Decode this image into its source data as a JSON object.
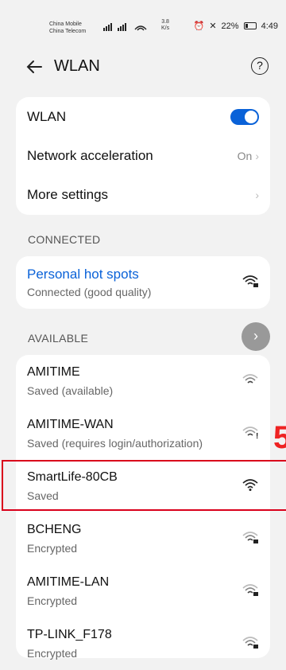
{
  "status": {
    "carrier1": "China Mobile",
    "carrier2": "China Telecom",
    "speed_value": "3.8",
    "speed_unit": "K/s",
    "battery": "22%",
    "time": "4:49"
  },
  "header": {
    "title": "WLAN"
  },
  "settings": {
    "wlan_label": "WLAN",
    "acceleration_label": "Network acceleration",
    "acceleration_value": "On",
    "more_label": "More settings"
  },
  "sections": {
    "connected": "CONNECTED",
    "available": "AVAILABLE"
  },
  "connected": {
    "name": "Personal  hot  spots",
    "status": "Connected (good quality)"
  },
  "available": [
    {
      "name": "AMITIME",
      "status": "Saved (available)"
    },
    {
      "name": "AMITIME-WAN",
      "status": "Saved (requires login/authorization)"
    },
    {
      "name": "SmartLife-80CB",
      "status": "Saved"
    },
    {
      "name": "BCHENG",
      "status": "Encrypted"
    },
    {
      "name": "AMITIME-LAN",
      "status": "Encrypted"
    },
    {
      "name": "TP-LINK_F178",
      "status": "Encrypted"
    }
  ],
  "annotation": {
    "number": "5"
  },
  "colors": {
    "accent": "#0a62d8",
    "highlight": "#d9001b"
  }
}
